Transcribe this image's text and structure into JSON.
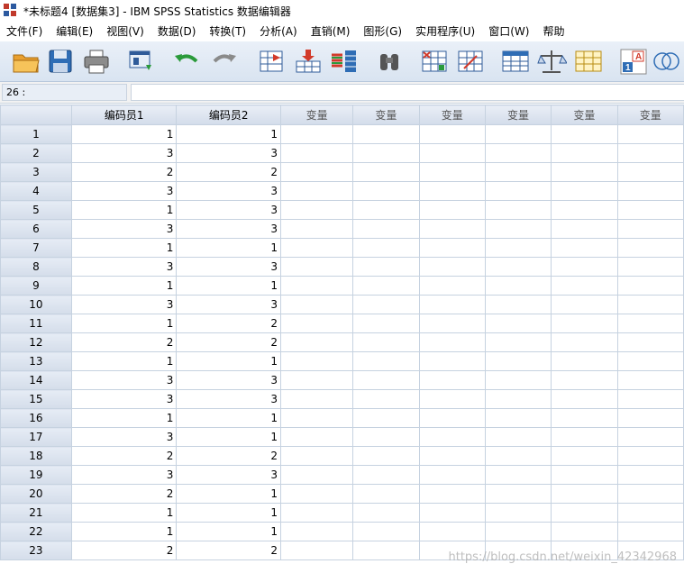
{
  "window": {
    "title": "*未标题4 [数据集3] - IBM SPSS Statistics 数据编辑器"
  },
  "menu": [
    "文件(F)",
    "编辑(E)",
    "视图(V)",
    "数据(D)",
    "转换(T)",
    "分析(A)",
    "直销(M)",
    "图形(G)",
    "实用程序(U)",
    "窗口(W)",
    "帮助"
  ],
  "toolbar": {
    "icons": [
      "open-folder-icon",
      "save-icon",
      "print-icon",
      "dialog-recall-icon",
      "undo-icon",
      "redo-icon",
      "goto-case-icon",
      "goto-variable-icon",
      "variables-icon",
      "find-icon",
      "insert-cases-icon",
      "insert-variable-icon",
      "split-file-icon",
      "weight-cases-icon",
      "select-cases-icon",
      "value-labels-icon",
      "use-sets-icon"
    ]
  },
  "cellbar": {
    "reference": "26 :",
    "value": ""
  },
  "grid": {
    "columns": [
      "编码员1",
      "编码员2",
      "变量",
      "变量",
      "变量",
      "变量",
      "变量",
      "变量"
    ],
    "rows": [
      {
        "num": "1",
        "v1": "1",
        "v2": "1"
      },
      {
        "num": "2",
        "v1": "3",
        "v2": "3"
      },
      {
        "num": "3",
        "v1": "2",
        "v2": "2"
      },
      {
        "num": "4",
        "v1": "3",
        "v2": "3"
      },
      {
        "num": "5",
        "v1": "1",
        "v2": "3"
      },
      {
        "num": "6",
        "v1": "3",
        "v2": "3"
      },
      {
        "num": "7",
        "v1": "1",
        "v2": "1"
      },
      {
        "num": "8",
        "v1": "3",
        "v2": "3"
      },
      {
        "num": "9",
        "v1": "1",
        "v2": "1"
      },
      {
        "num": "10",
        "v1": "3",
        "v2": "3"
      },
      {
        "num": "11",
        "v1": "1",
        "v2": "2"
      },
      {
        "num": "12",
        "v1": "2",
        "v2": "2"
      },
      {
        "num": "13",
        "v1": "1",
        "v2": "1"
      },
      {
        "num": "14",
        "v1": "3",
        "v2": "3"
      },
      {
        "num": "15",
        "v1": "3",
        "v2": "3"
      },
      {
        "num": "16",
        "v1": "1",
        "v2": "1"
      },
      {
        "num": "17",
        "v1": "3",
        "v2": "1"
      },
      {
        "num": "18",
        "v1": "2",
        "v2": "2"
      },
      {
        "num": "19",
        "v1": "3",
        "v2": "3"
      },
      {
        "num": "20",
        "v1": "2",
        "v2": "1"
      },
      {
        "num": "21",
        "v1": "1",
        "v2": "1"
      },
      {
        "num": "22",
        "v1": "1",
        "v2": "1"
      },
      {
        "num": "23",
        "v1": "2",
        "v2": "2"
      }
    ]
  },
  "watermark": "https://blog.csdn.net/weixin_42342968"
}
